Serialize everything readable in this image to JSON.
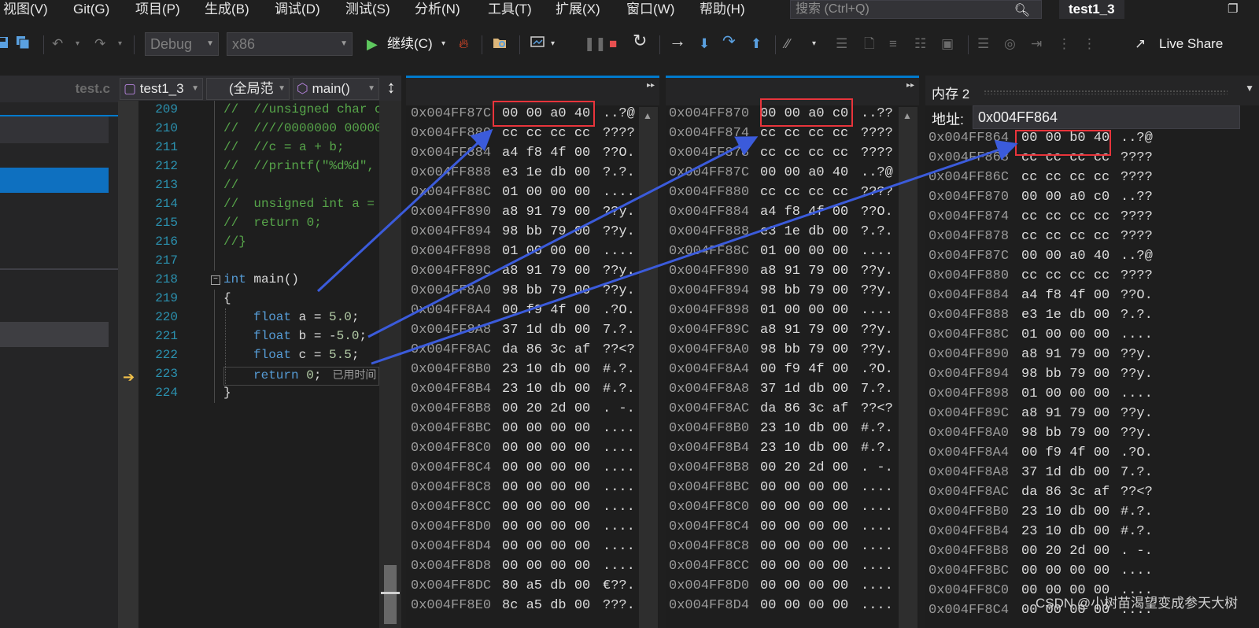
{
  "menu": {
    "items": [
      "视图(V)",
      "Git(G)",
      "项目(P)",
      "生成(B)",
      "调试(D)",
      "测试(S)",
      "分析(N)",
      "工具(T)",
      "扩展(X)",
      "窗口(W)",
      "帮助(H)"
    ],
    "search_placeholder": "搜索 (Ctrl+Q)",
    "window_title": "test1_3"
  },
  "toolbar": {
    "config": "Debug",
    "platform": "x86",
    "continue_label": "继续(C)",
    "live_share": "Live Share"
  },
  "left_panel": {
    "tab": "test.c"
  },
  "nav": {
    "project": "test1_3",
    "scope": "(全局范",
    "function": "main()"
  },
  "editor": {
    "lines": [
      {
        "n": "209",
        "code": "//  //unsigned char c"
      },
      {
        "n": "210",
        "code": "//  ////0000000 00000"
      },
      {
        "n": "211",
        "code": "//  //c = a + b;"
      },
      {
        "n": "212",
        "code": "//  //printf(\"%d%d\","
      },
      {
        "n": "213",
        "code": "//"
      },
      {
        "n": "214",
        "code": "//  unsigned int a ="
      },
      {
        "n": "215",
        "code": "//  return 0;"
      },
      {
        "n": "216",
        "code": "//}"
      },
      {
        "n": "217",
        "code": ""
      },
      {
        "n": "218",
        "kw": "int",
        "rest": " main()"
      },
      {
        "n": "219",
        "code": "{"
      },
      {
        "n": "220",
        "kw": "float",
        "rest": " a = ",
        "num": "5.0",
        "end": ";"
      },
      {
        "n": "221",
        "kw": "float",
        "rest": " b = -",
        "num": "5.0",
        "end": ";"
      },
      {
        "n": "222",
        "kw": "float",
        "rest": " c = ",
        "num": "5.5",
        "end": ";"
      },
      {
        "n": "223",
        "kw": "return",
        "rest": " ",
        "num": "0",
        "end": ";",
        "hint": "已用时间"
      },
      {
        "n": "224",
        "code": "}"
      }
    ]
  },
  "memory1": {
    "rows": [
      [
        "0x004FF87C",
        "00 00 a0 40",
        "..?@"
      ],
      [
        "0x004FF880",
        "cc cc cc cc",
        "????"
      ],
      [
        "0x004FF884",
        "a4 f8 4f 00",
        "??O."
      ],
      [
        "0x004FF888",
        "e3 1e db 00",
        "?.?."
      ],
      [
        "0x004FF88C",
        "01 00 00 00",
        "...."
      ],
      [
        "0x004FF890",
        "a8 91 79 00",
        "??y."
      ],
      [
        "0x004FF894",
        "98 bb 79 00",
        "??y."
      ],
      [
        "0x004FF898",
        "01 00 00 00",
        "...."
      ],
      [
        "0x004FF89C",
        "a8 91 79 00",
        "??y."
      ],
      [
        "0x004FF8A0",
        "98 bb 79 00",
        "??y."
      ],
      [
        "0x004FF8A4",
        "00 f9 4f 00",
        ".?O."
      ],
      [
        "0x004FF8A8",
        "37 1d db 00",
        "7.?."
      ],
      [
        "0x004FF8AC",
        "da 86 3c af",
        "??<?"
      ],
      [
        "0x004FF8B0",
        "23 10 db 00",
        "#.?."
      ],
      [
        "0x004FF8B4",
        "23 10 db 00",
        "#.?."
      ],
      [
        "0x004FF8B8",
        "00 20 2d 00",
        ". -."
      ],
      [
        "0x004FF8BC",
        "00 00 00 00",
        "...."
      ],
      [
        "0x004FF8C0",
        "00 00 00 00",
        "...."
      ],
      [
        "0x004FF8C4",
        "00 00 00 00",
        "...."
      ],
      [
        "0x004FF8C8",
        "00 00 00 00",
        "...."
      ],
      [
        "0x004FF8CC",
        "00 00 00 00",
        "...."
      ],
      [
        "0x004FF8D0",
        "00 00 00 00",
        "...."
      ],
      [
        "0x004FF8D4",
        "00 00 00 00",
        "...."
      ],
      [
        "0x004FF8D8",
        "00 00 00 00",
        "...."
      ],
      [
        "0x004FF8DC",
        "80 a5 db 00",
        "€??."
      ],
      [
        "0x004FF8E0",
        "8c a5 db 00",
        "???."
      ]
    ]
  },
  "memory2": {
    "rows": [
      [
        "0x004FF870",
        "00 00 a0 c0",
        "..??"
      ],
      [
        "0x004FF874",
        "cc cc cc cc",
        "????"
      ],
      [
        "0x004FF878",
        "cc cc cc cc",
        "????"
      ],
      [
        "0x004FF87C",
        "00 00 a0 40",
        "..?@"
      ],
      [
        "0x004FF880",
        "cc cc cc cc",
        "????"
      ],
      [
        "0x004FF884",
        "a4 f8 4f 00",
        "??O."
      ],
      [
        "0x004FF888",
        "e3 1e db 00",
        "?.?."
      ],
      [
        "0x004FF88C",
        "01 00 00 00",
        "...."
      ],
      [
        "0x004FF890",
        "a8 91 79 00",
        "??y."
      ],
      [
        "0x004FF894",
        "98 bb 79 00",
        "??y."
      ],
      [
        "0x004FF898",
        "01 00 00 00",
        "...."
      ],
      [
        "0x004FF89C",
        "a8 91 79 00",
        "??y."
      ],
      [
        "0x004FF8A0",
        "98 bb 79 00",
        "??y."
      ],
      [
        "0x004FF8A4",
        "00 f9 4f 00",
        ".?O."
      ],
      [
        "0x004FF8A8",
        "37 1d db 00",
        "7.?."
      ],
      [
        "0x004FF8AC",
        "da 86 3c af",
        "??<?"
      ],
      [
        "0x004FF8B0",
        "23 10 db 00",
        "#.?."
      ],
      [
        "0x004FF8B4",
        "23 10 db 00",
        "#.?."
      ],
      [
        "0x004FF8B8",
        "00 20 2d 00",
        ". -."
      ],
      [
        "0x004FF8BC",
        "00 00 00 00",
        "...."
      ],
      [
        "0x004FF8C0",
        "00 00 00 00",
        "...."
      ],
      [
        "0x004FF8C4",
        "00 00 00 00",
        "...."
      ],
      [
        "0x004FF8C8",
        "00 00 00 00",
        "...."
      ],
      [
        "0x004FF8CC",
        "00 00 00 00",
        "...."
      ],
      [
        "0x004FF8D0",
        "00 00 00 00",
        "...."
      ],
      [
        "0x004FF8D4",
        "00 00 00 00",
        "...."
      ]
    ]
  },
  "memory3": {
    "title": "内存 2",
    "address_label": "地址:",
    "address_value": "0x004FF864",
    "rows": [
      [
        "0x004FF864",
        "00 00 b0 40",
        "..?@"
      ],
      [
        "0x004FF868",
        "cc cc cc cc",
        "????"
      ],
      [
        "0x004FF86C",
        "cc cc cc cc",
        "????"
      ],
      [
        "0x004FF870",
        "00 00 a0 c0",
        "..??"
      ],
      [
        "0x004FF874",
        "cc cc cc cc",
        "????"
      ],
      [
        "0x004FF878",
        "cc cc cc cc",
        "????"
      ],
      [
        "0x004FF87C",
        "00 00 a0 40",
        "..?@"
      ],
      [
        "0x004FF880",
        "cc cc cc cc",
        "????"
      ],
      [
        "0x004FF884",
        "a4 f8 4f 00",
        "??O."
      ],
      [
        "0x004FF888",
        "e3 1e db 00",
        "?.?."
      ],
      [
        "0x004FF88C",
        "01 00 00 00",
        "...."
      ],
      [
        "0x004FF890",
        "a8 91 79 00",
        "??y."
      ],
      [
        "0x004FF894",
        "98 bb 79 00",
        "??y."
      ],
      [
        "0x004FF898",
        "01 00 00 00",
        "...."
      ],
      [
        "0x004FF89C",
        "a8 91 79 00",
        "??y."
      ],
      [
        "0x004FF8A0",
        "98 bb 79 00",
        "??y."
      ],
      [
        "0x004FF8A4",
        "00 f9 4f 00",
        ".?O."
      ],
      [
        "0x004FF8A8",
        "37 1d db 00",
        "7.?."
      ],
      [
        "0x004FF8AC",
        "da 86 3c af",
        "??<?"
      ],
      [
        "0x004FF8B0",
        "23 10 db 00",
        "#.?."
      ],
      [
        "0x004FF8B4",
        "23 10 db 00",
        "#.?."
      ],
      [
        "0x004FF8B8",
        "00 20 2d 00",
        ". -."
      ],
      [
        "0x004FF8BC",
        "00 00 00 00",
        "...."
      ],
      [
        "0x004FF8C0",
        "00 00 00 00",
        "...."
      ],
      [
        "0x004FF8C4",
        "00 00 00 00",
        "...."
      ]
    ]
  },
  "watermark": "CSDN @小树苗渴望变成参天大树",
  "colors": {
    "highlight_box": "#e8343b",
    "annotation_arrow": "#3b5bdb",
    "accent": "#007acc"
  }
}
